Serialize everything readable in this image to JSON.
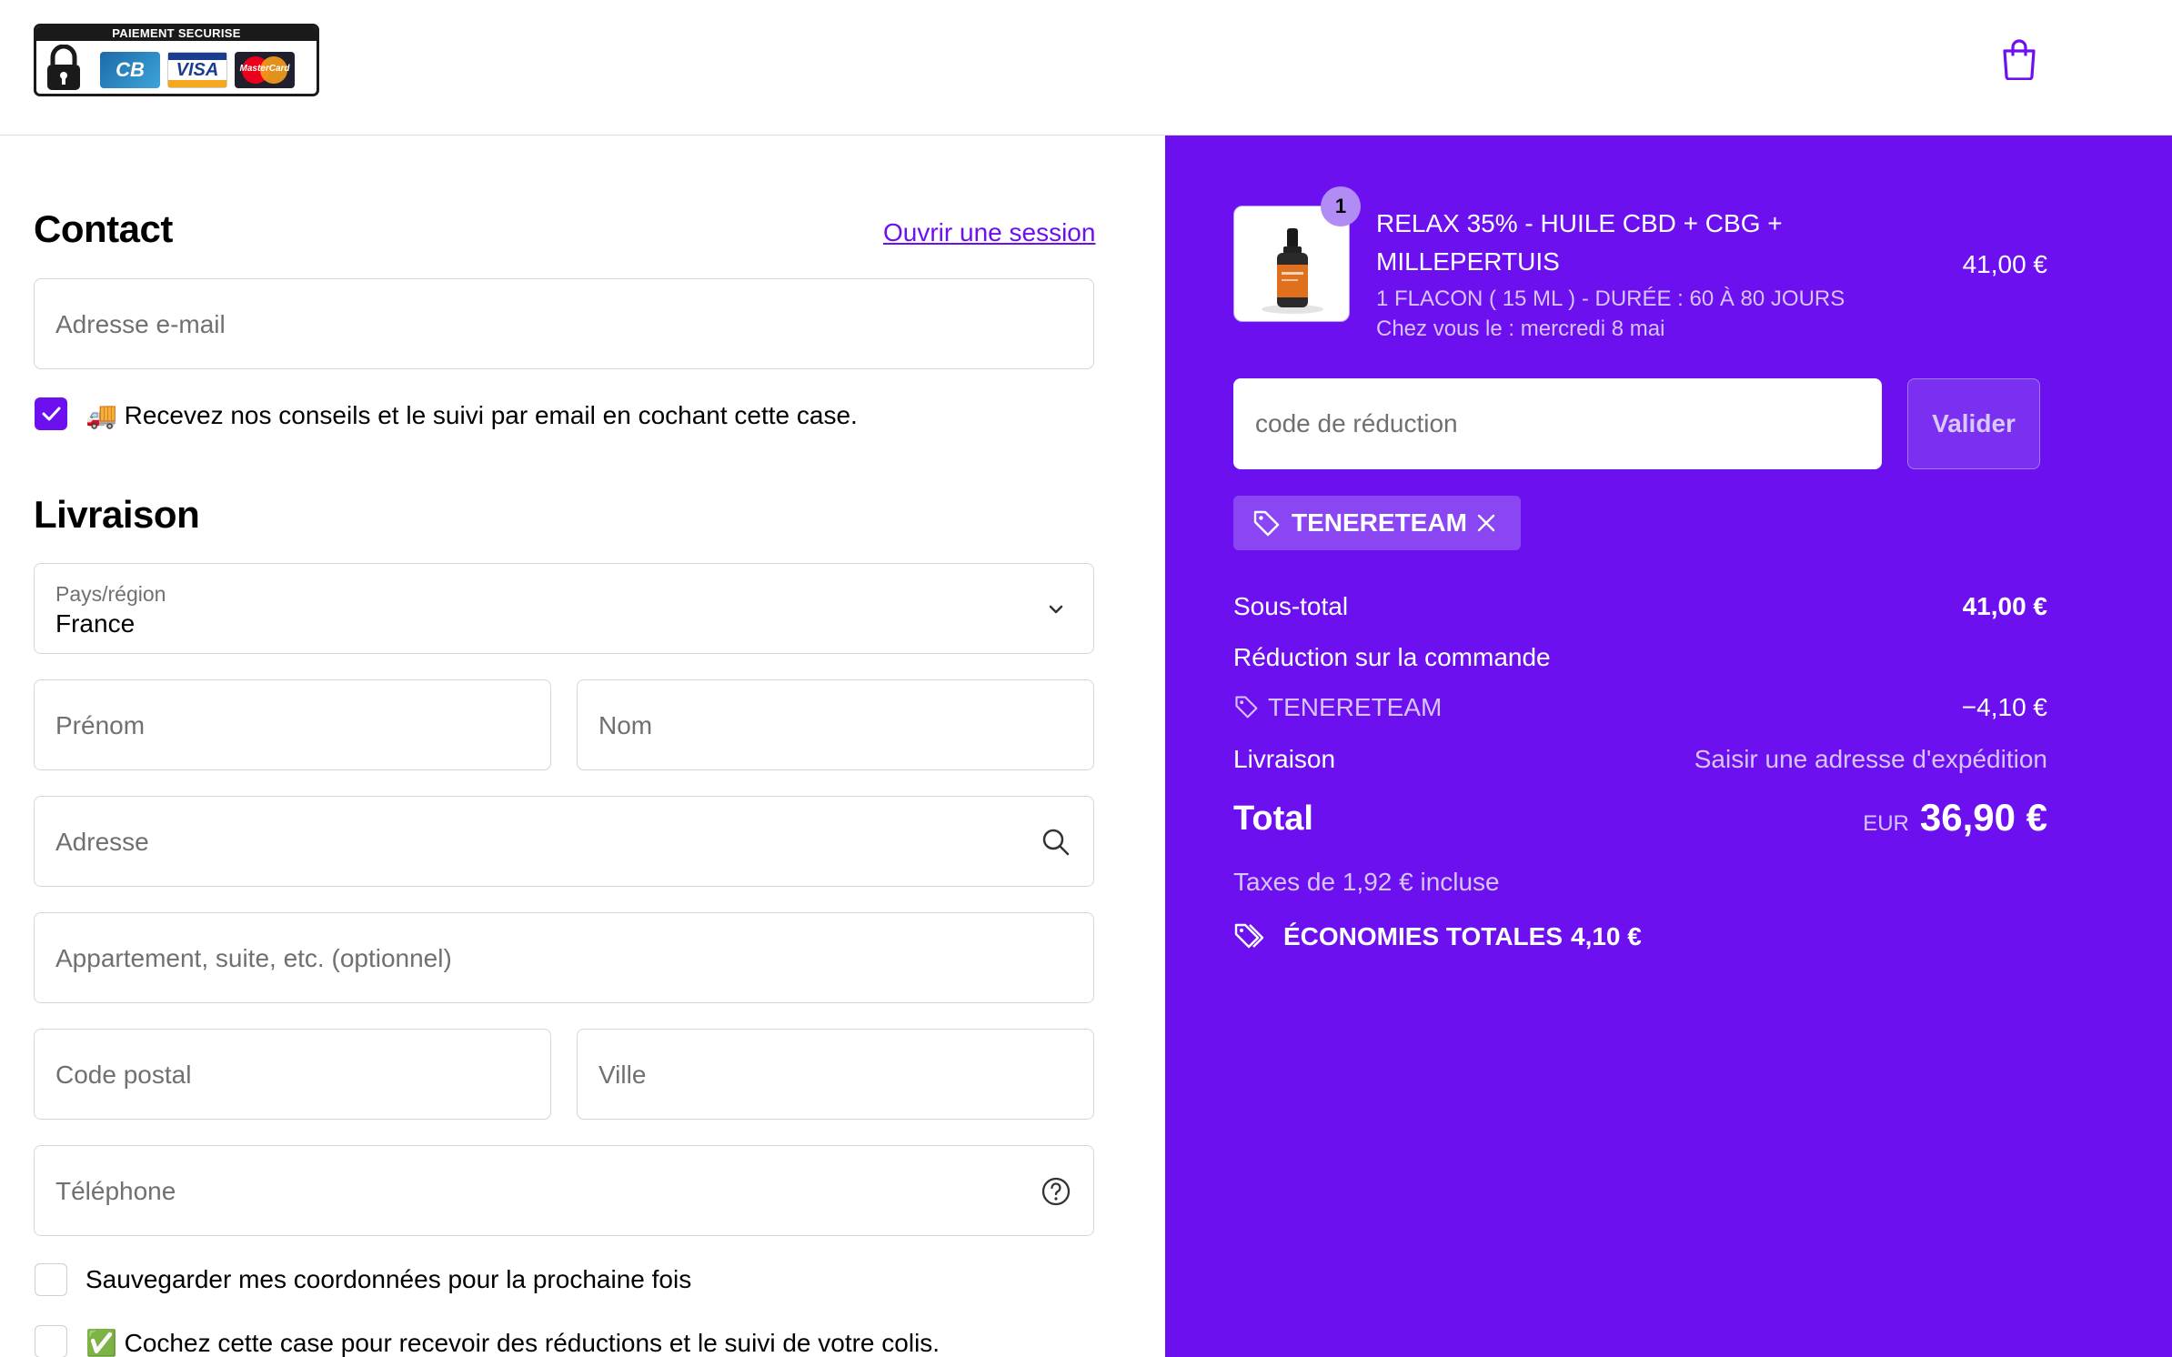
{
  "header": {
    "badge_title": "PAIEMENT SECURISE",
    "cards": [
      "CB",
      "VISA",
      "MasterCard"
    ],
    "icons": [
      "lock-icon",
      "shopping-bag-icon"
    ]
  },
  "contact": {
    "title": "Contact",
    "login_link": "Ouvrir une session",
    "email_placeholder": "Adresse e-mail",
    "newsletter_label": "🚚 Recevez nos conseils et le suivi par email en cochant cette case."
  },
  "delivery": {
    "title": "Livraison",
    "country_label": "Pays/région",
    "country_value": "France",
    "first_name_placeholder": "Prénom",
    "last_name_placeholder": "Nom",
    "address_placeholder": "Adresse",
    "apartment_placeholder": "Appartement, suite, etc. (optionnel)",
    "postal_placeholder": "Code postal",
    "city_placeholder": "Ville",
    "phone_placeholder": "Téléphone",
    "save_label": "Sauvegarder mes coordonnées pour la prochaine fois",
    "sms_label": "✅ Cochez cette case pour recevoir des réductions et le suivi de votre colis."
  },
  "summary": {
    "product": {
      "quantity": "1",
      "name": "RELAX 35% - HUILE CBD + CBG + MILLEPERTUIS",
      "variant": "1 FLACON ( 15 ML ) - DURÉE : 60 À 80 JOURS",
      "delivery": "Chez vous le : mercredi 8 mai",
      "price": "41,00 €"
    },
    "discount_placeholder": "code de réduction",
    "discount_button": "Valider",
    "applied_code": "TENERETEAM",
    "subtotal_label": "Sous-total",
    "subtotal_value": "41,00 €",
    "order_discount_label": "Réduction sur la commande",
    "discount_code_label": "TENERETEAM",
    "discount_value": "−4,10 €",
    "shipping_label": "Livraison",
    "shipping_value": "Saisir une adresse d'expédition",
    "total_label": "Total",
    "currency": "EUR",
    "total_value": "36,90 €",
    "taxes": "Taxes de 1,92 € incluse",
    "savings_label": "ÉCONOMIES TOTALES",
    "savings_value": "4,10 €"
  },
  "colors": {
    "accent": "#6d10ef",
    "panel_bg": "#6d10ef"
  }
}
